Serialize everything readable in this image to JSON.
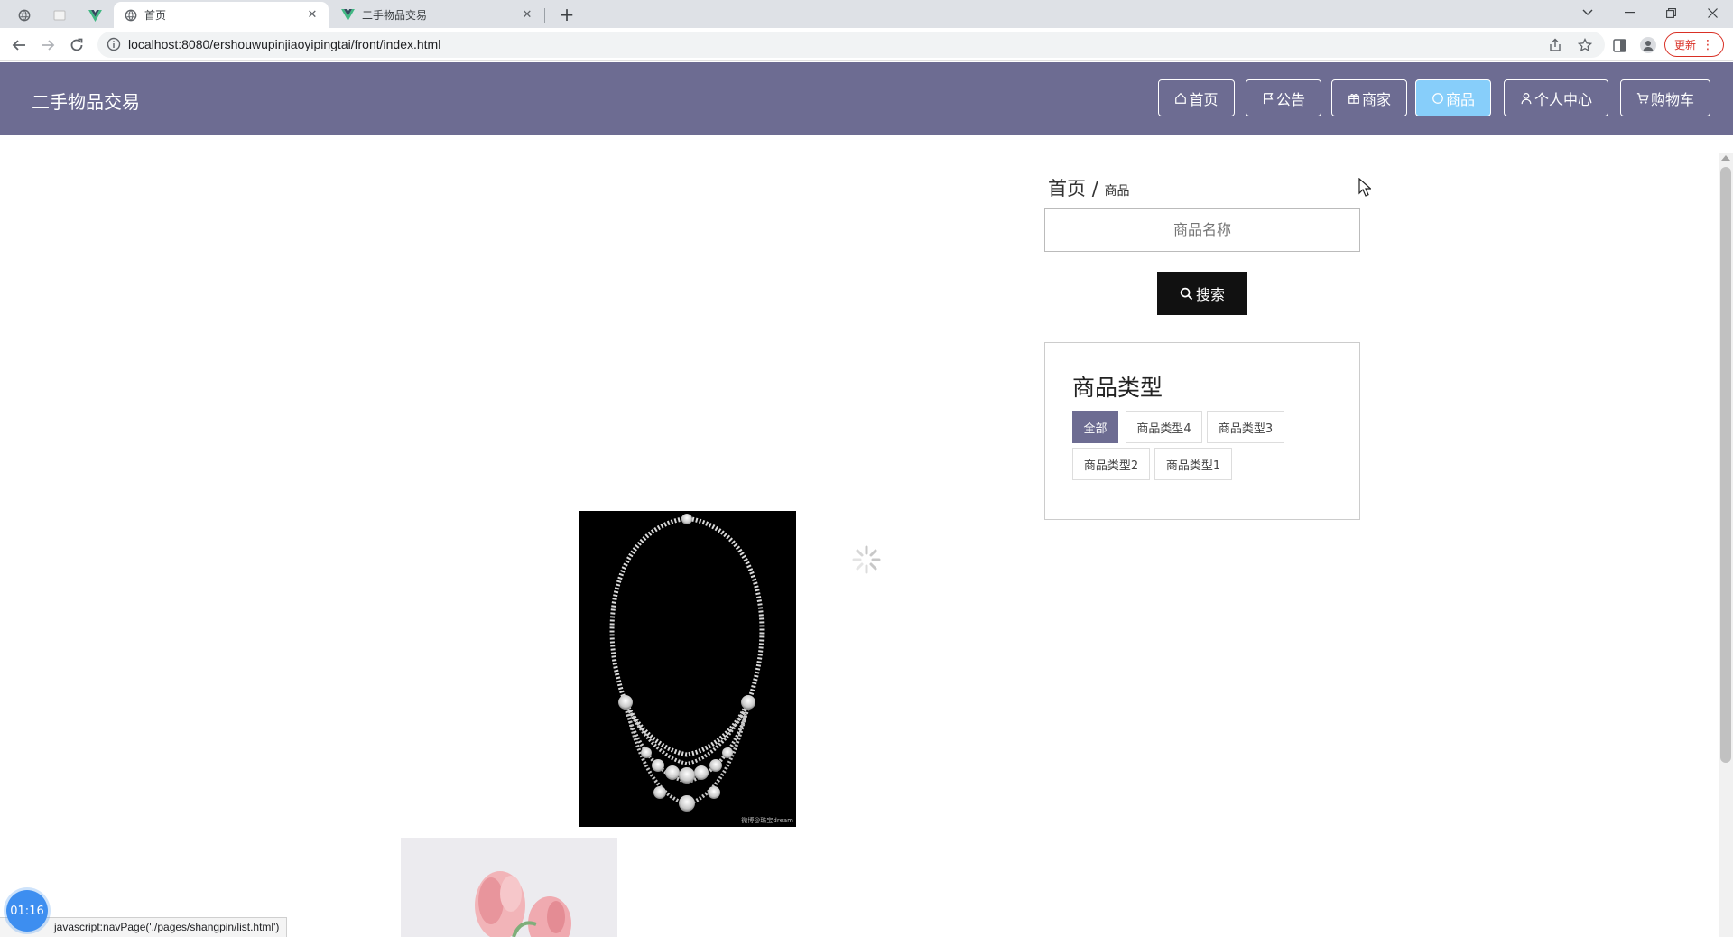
{
  "browser": {
    "tabs": [
      {
        "title": "首页",
        "active": true
      },
      {
        "title": "二手物品交易",
        "active": false
      }
    ],
    "url": "localhost:8080/ershouwupinjiaoyipingtai/front/index.html",
    "update_label": "更新",
    "status_text": "javascript:navPage('./pages/shangpin/list.html')"
  },
  "header": {
    "title": "二手物品交易",
    "nav": [
      {
        "label": "首页",
        "icon": "home-icon",
        "active": false
      },
      {
        "label": "公告",
        "icon": "flag-icon",
        "active": false
      },
      {
        "label": "商家",
        "icon": "gift-icon",
        "active": false
      },
      {
        "label": "商品",
        "icon": "circle-icon",
        "active": true
      },
      {
        "label": "个人中心",
        "icon": "user-icon",
        "active": false
      },
      {
        "label": "购物车",
        "icon": "cart-icon",
        "active": false
      }
    ]
  },
  "breadcrumb": {
    "root": "首页",
    "separator": "/",
    "current": "商品"
  },
  "search": {
    "placeholder": "商品名称",
    "button_label": "搜索"
  },
  "categories": {
    "title": "商品类型",
    "items": [
      {
        "label": "全部",
        "active": true
      },
      {
        "label": "商品类型4",
        "active": false
      },
      {
        "label": "商品类型3",
        "active": false
      },
      {
        "label": "商品类型2",
        "active": false
      },
      {
        "label": "商品类型1",
        "active": false
      }
    ]
  },
  "product_images": {
    "necklace_watermark": "微博@珠宝dream"
  },
  "timer": "01:16",
  "colors": {
    "header_bg": "#6d6c92",
    "active_nav": "#87cefa",
    "search_button": "#111111"
  }
}
